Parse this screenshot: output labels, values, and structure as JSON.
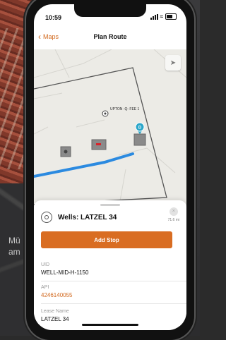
{
  "background": {
    "text_lines": [
      "Mü",
      "am"
    ]
  },
  "status_bar": {
    "time": "10:59"
  },
  "nav": {
    "back_label": "Maps",
    "title": "Plan Route"
  },
  "map": {
    "marker_label": "UPTON -Q- FEE 1",
    "destination_badge": "D"
  },
  "sheet": {
    "title": "Wells: LATZEL 34",
    "distance": "71.6 mi",
    "add_stop_label": "Add Stop",
    "fields": [
      {
        "label": "UID",
        "value": "WELL-MID-H-1150"
      },
      {
        "label": "API",
        "value": "4246140055"
      },
      {
        "label": "Lease Name",
        "value": "LATZEL 34"
      }
    ]
  },
  "colors": {
    "accent": "#d96d22",
    "route": "#2b8ae0",
    "pin": "#2aa6c9"
  }
}
